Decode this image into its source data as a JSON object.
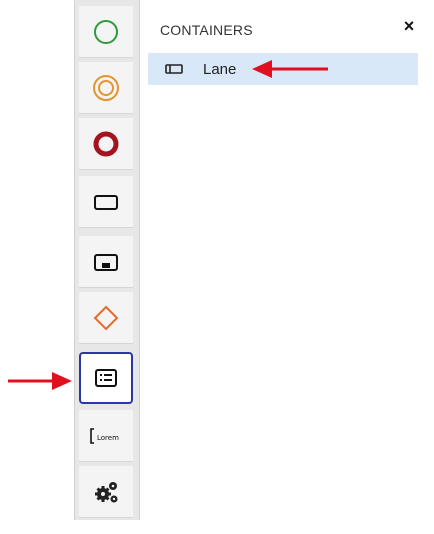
{
  "panel": {
    "title": "CONTAINERS",
    "close_label": "×",
    "items": [
      {
        "label": "Lane",
        "icon": "lane-icon",
        "selected": true
      }
    ]
  },
  "toolbar": {
    "tools": [
      {
        "icon": "start-event-icon"
      },
      {
        "icon": "intermediate-event-icon"
      },
      {
        "icon": "end-event-icon"
      },
      {
        "icon": "task-icon"
      },
      {
        "icon": "subprocess-icon"
      },
      {
        "icon": "gateway-icon"
      },
      {
        "icon": "containers-icon",
        "selected": true
      },
      {
        "icon": "annotation-icon",
        "label": "[Lorem"
      },
      {
        "icon": "settings-gears-icon"
      }
    ]
  },
  "colors": {
    "start": "#2e9a3a",
    "intermediate": "#e3962d",
    "end": "#a3141f",
    "gateway": "#ea6a2a",
    "selection_border": "#2b37a6",
    "highlight": "#d8e8f8",
    "arrow": "#e0101e"
  }
}
